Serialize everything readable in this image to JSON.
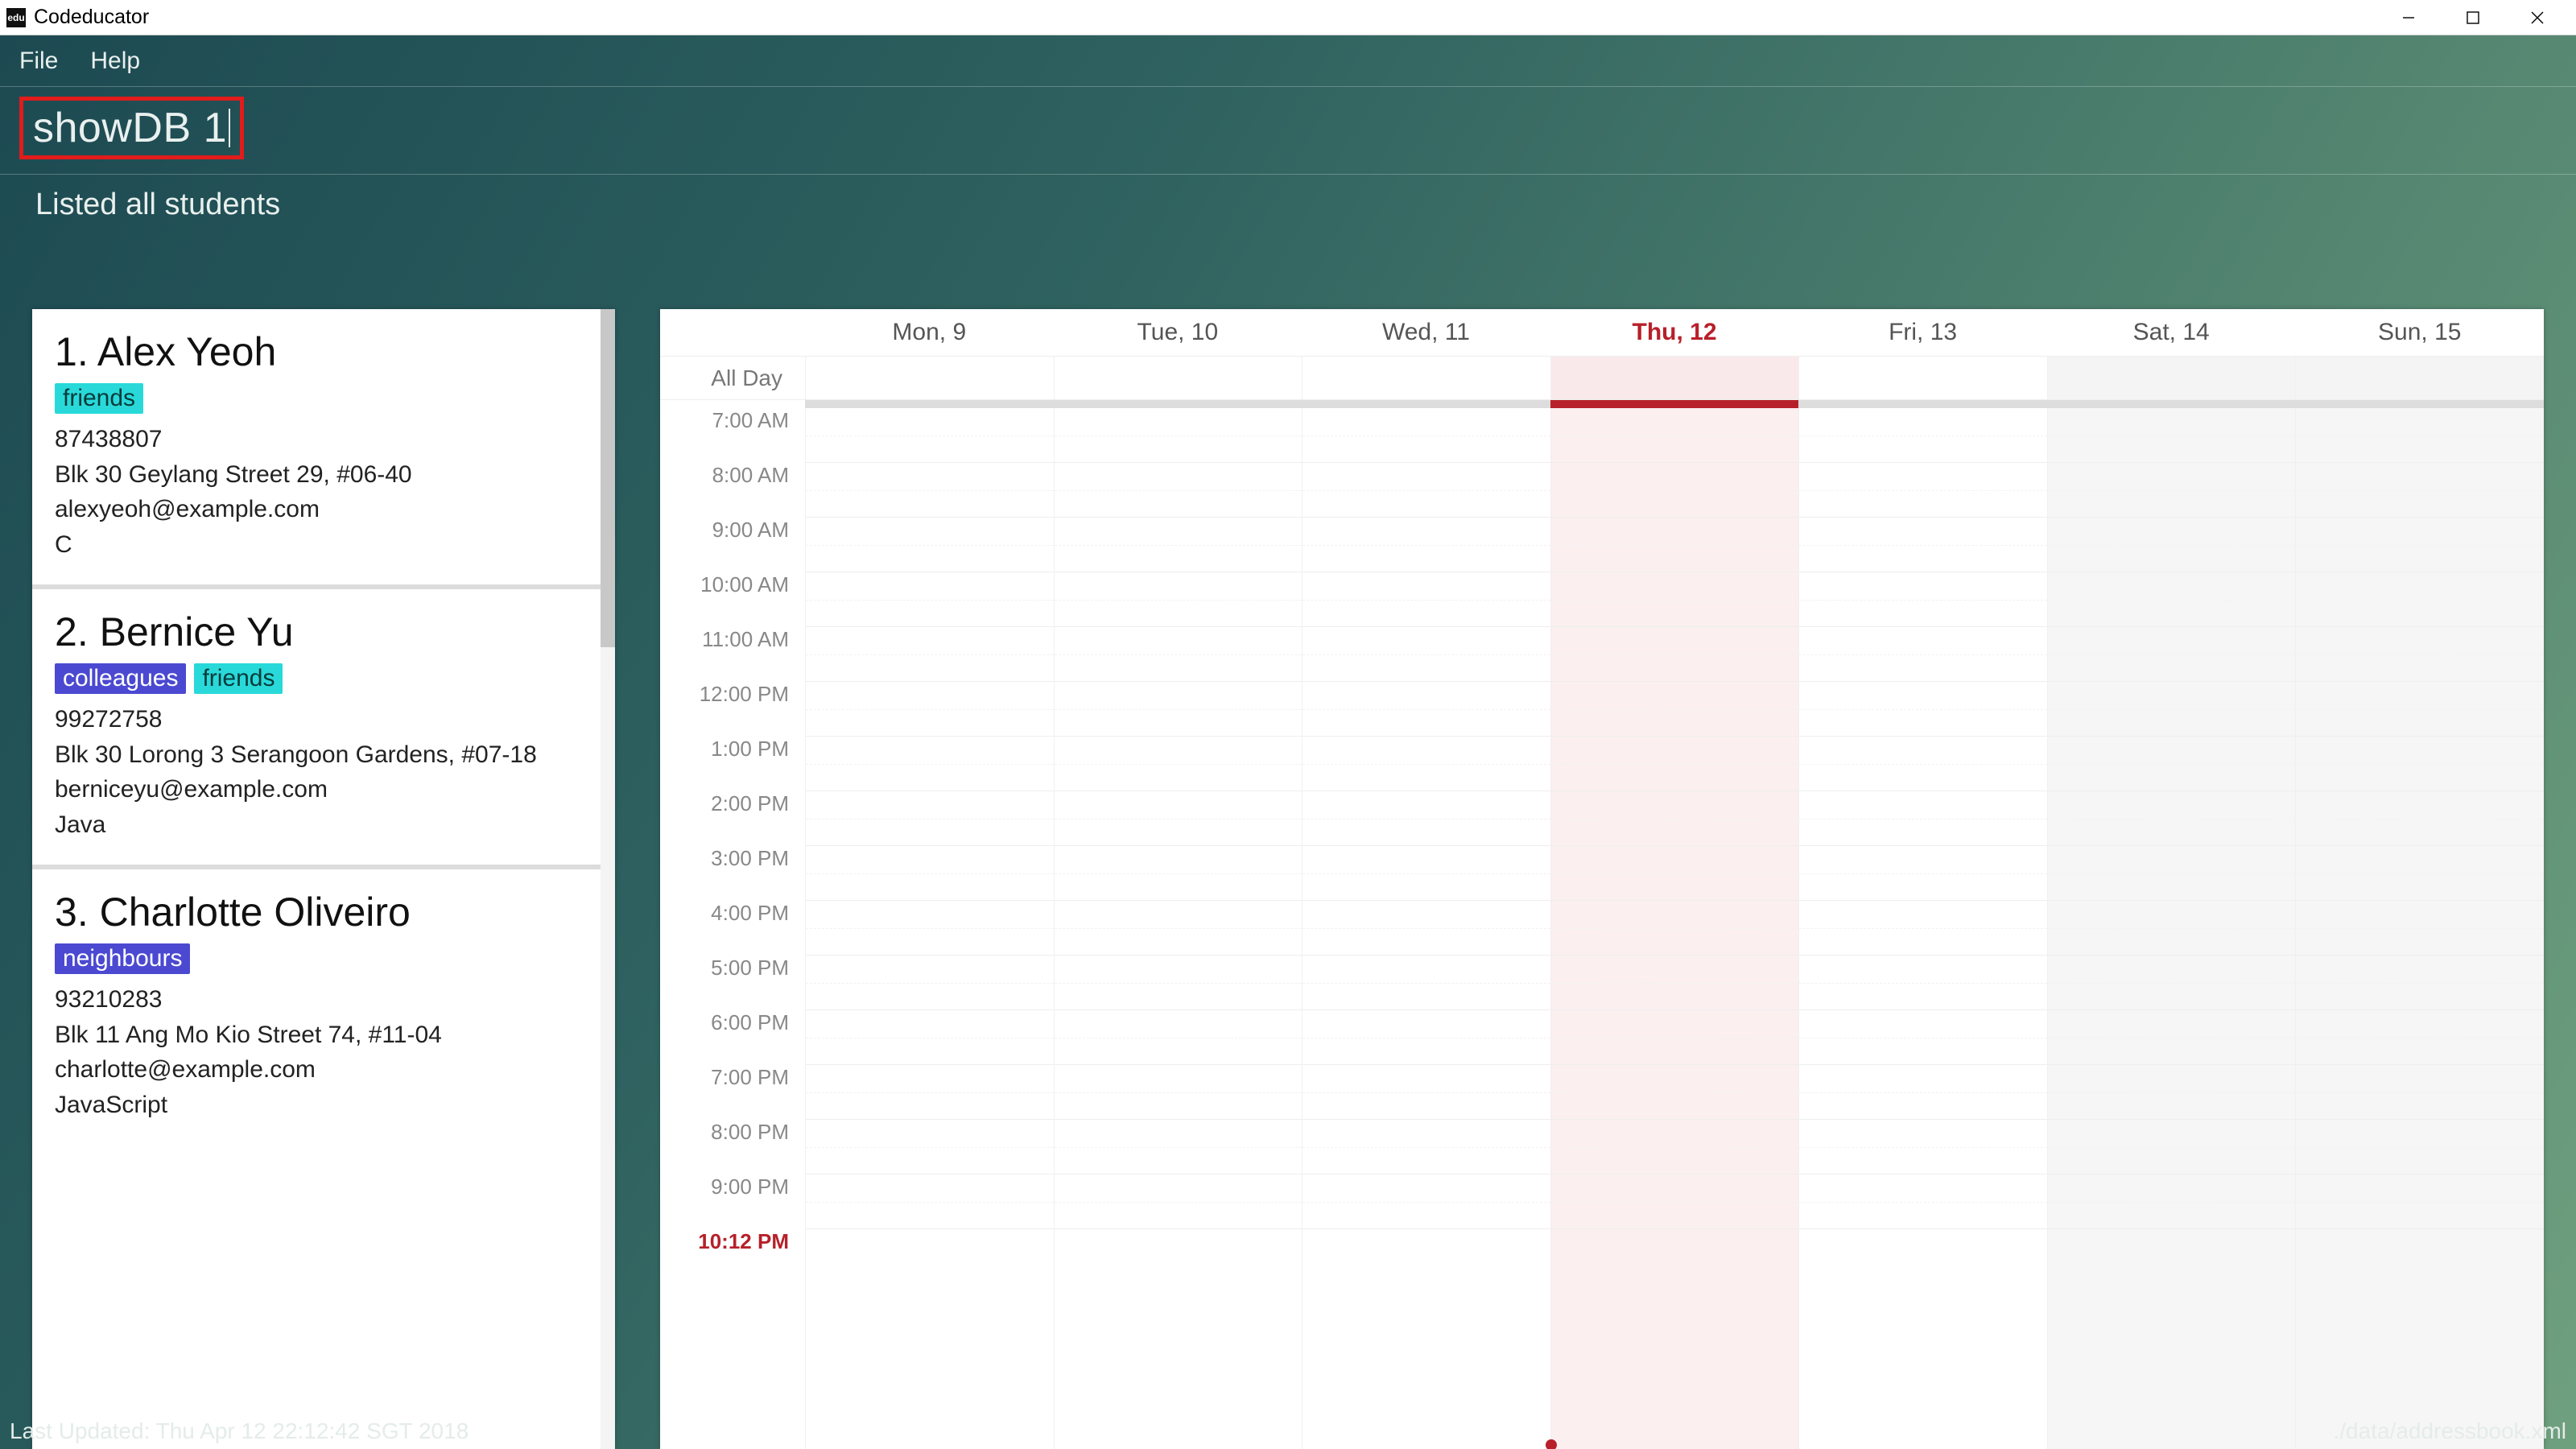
{
  "window": {
    "title": "Codeducator",
    "icon_text": "edu"
  },
  "menu": {
    "items": [
      "File",
      "Help"
    ]
  },
  "command": {
    "text": "showDB 1"
  },
  "status": {
    "message": "Listed all students"
  },
  "tagColors": {
    "friends": "#29d9d9",
    "colleagues": "#4b49d1",
    "neighbours": "#4b49d1"
  },
  "students": [
    {
      "index": "1",
      "name": "Alex Yeoh",
      "tags": [
        "friends"
      ],
      "phone": "87438807",
      "address": "Blk 30 Geylang Street 29, #06-40",
      "email": "alexyeoh@example.com",
      "lang": "C"
    },
    {
      "index": "2",
      "name": "Bernice Yu",
      "tags": [
        "colleagues",
        "friends"
      ],
      "phone": "99272758",
      "address": "Blk 30 Lorong 3 Serangoon Gardens, #07-18",
      "email": "berniceyu@example.com",
      "lang": "Java"
    },
    {
      "index": "3",
      "name": "Charlotte Oliveiro",
      "tags": [
        "neighbours"
      ],
      "phone": "93210283",
      "address": "Blk 11 Ang Mo Kio Street 74, #11-04",
      "email": "charlotte@example.com",
      "lang": "JavaScript"
    }
  ],
  "calendar": {
    "alldayLabel": "All Day",
    "days": [
      {
        "label": "Mon, 9",
        "today": false,
        "weekend": false
      },
      {
        "label": "Tue, 10",
        "today": false,
        "weekend": false
      },
      {
        "label": "Wed, 11",
        "today": false,
        "weekend": false
      },
      {
        "label": "Thu, 12",
        "today": true,
        "weekend": false
      },
      {
        "label": "Fri, 13",
        "today": false,
        "weekend": false
      },
      {
        "label": "Sat, 14",
        "today": false,
        "weekend": true
      },
      {
        "label": "Sun, 15",
        "today": false,
        "weekend": true
      }
    ],
    "hours": [
      "7:00 AM",
      "8:00 AM",
      "9:00 AM",
      "10:00 AM",
      "11:00 AM",
      "12:00 PM",
      "1:00 PM",
      "2:00 PM",
      "3:00 PM",
      "4:00 PM",
      "5:00 PM",
      "6:00 PM",
      "7:00 PM",
      "8:00 PM",
      "9:00 PM"
    ],
    "currentTimeLabel": "10:12 PM"
  },
  "footer": {
    "lastUpdated": "Last Updated: Thu Apr 12 22:12:42 SGT 2018",
    "filepath": "./data/addressbook.xml"
  }
}
